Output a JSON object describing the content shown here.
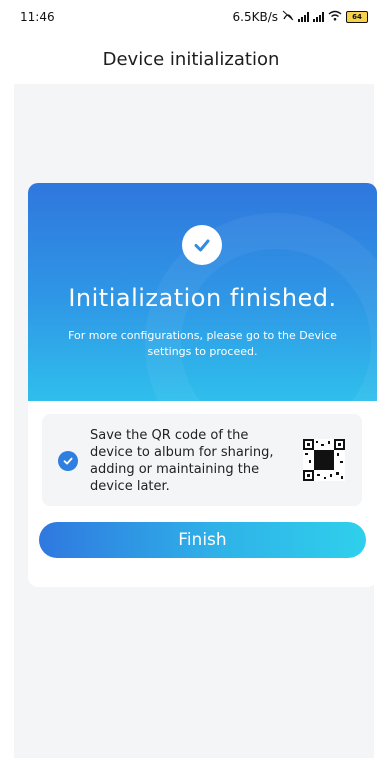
{
  "status_bar": {
    "time": "11:46",
    "speed": "6.5KB/s",
    "battery": "64"
  },
  "header": {
    "title": "Device initialization"
  },
  "hero": {
    "title": "Initialization finished.",
    "description": "For more configurations, please go to the Device settings to proceed."
  },
  "qr_option": {
    "checked": true,
    "text": "Save the QR code of the device to album for sharing, adding or maintaining the device later."
  },
  "finish_button": {
    "label": "Finish"
  },
  "colors": {
    "accent": "#2f7fe0",
    "hero_top": "#2f77dd",
    "hero_bottom": "#2fbfec",
    "page_background": "#f4f5f7"
  },
  "icons": {
    "status": [
      "nfc-icon",
      "signal-icon",
      "signal-icon",
      "wifi-icon",
      "battery-icon"
    ],
    "hero": "check-circle-icon",
    "option": "checkbox-checked-icon",
    "qr": "qr-code-icon"
  }
}
